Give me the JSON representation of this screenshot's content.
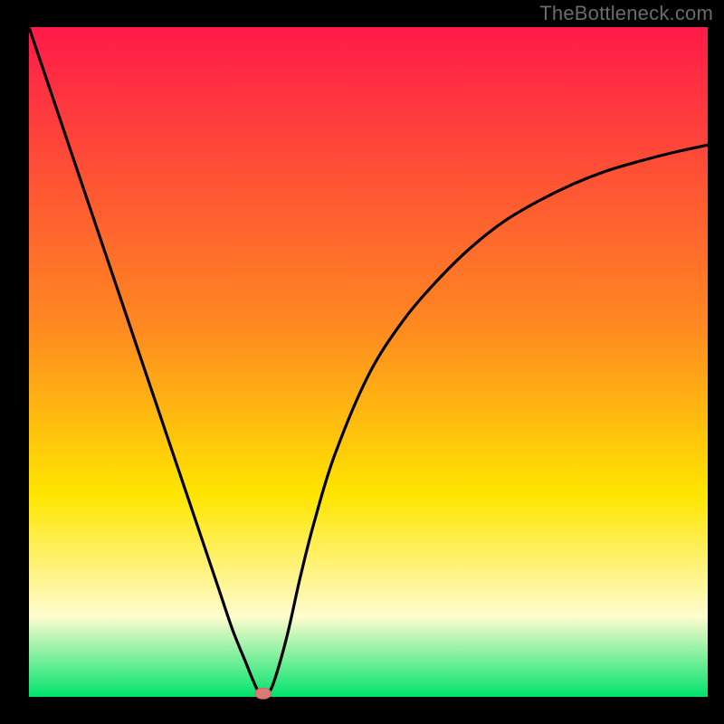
{
  "watermark": "TheBottleneck.com",
  "chart_data": {
    "type": "line",
    "title": "",
    "xlabel": "",
    "ylabel": "",
    "xlim": [
      0,
      100
    ],
    "ylim": [
      0,
      100
    ],
    "grid": false,
    "legend": false,
    "annotations": [],
    "colors": {
      "gradient_top": "#ff1a49",
      "gradient_mid1": "#ff8a20",
      "gradient_mid2": "#ffe600",
      "gradient_low": "#fffccf",
      "gradient_bottom": "#00e36b",
      "curve": "#000000",
      "marker_fill": "#d97a78",
      "marker_stroke": "#c96865"
    },
    "series": [
      {
        "name": "bottleneck-curve",
        "x": [
          0,
          2,
          4,
          6,
          8,
          10,
          12,
          14,
          16,
          18,
          20,
          22,
          24,
          26,
          28,
          30,
          32,
          33,
          34,
          35,
          36,
          38,
          40,
          42,
          45,
          50,
          55,
          60,
          65,
          70,
          75,
          80,
          85,
          90,
          95,
          100
        ],
        "values": [
          100,
          94,
          88,
          82,
          76,
          70,
          64,
          58,
          52,
          46,
          40,
          34,
          28,
          22,
          16,
          10,
          5,
          2.5,
          0.5,
          0.5,
          2,
          9,
          18,
          26,
          36,
          48,
          56,
          62,
          67,
          71,
          74,
          76.5,
          78.5,
          80,
          81.3,
          82.4
        ]
      }
    ],
    "marker": {
      "name": "optimal-point",
      "x": 34.5,
      "y": 0.5
    }
  }
}
